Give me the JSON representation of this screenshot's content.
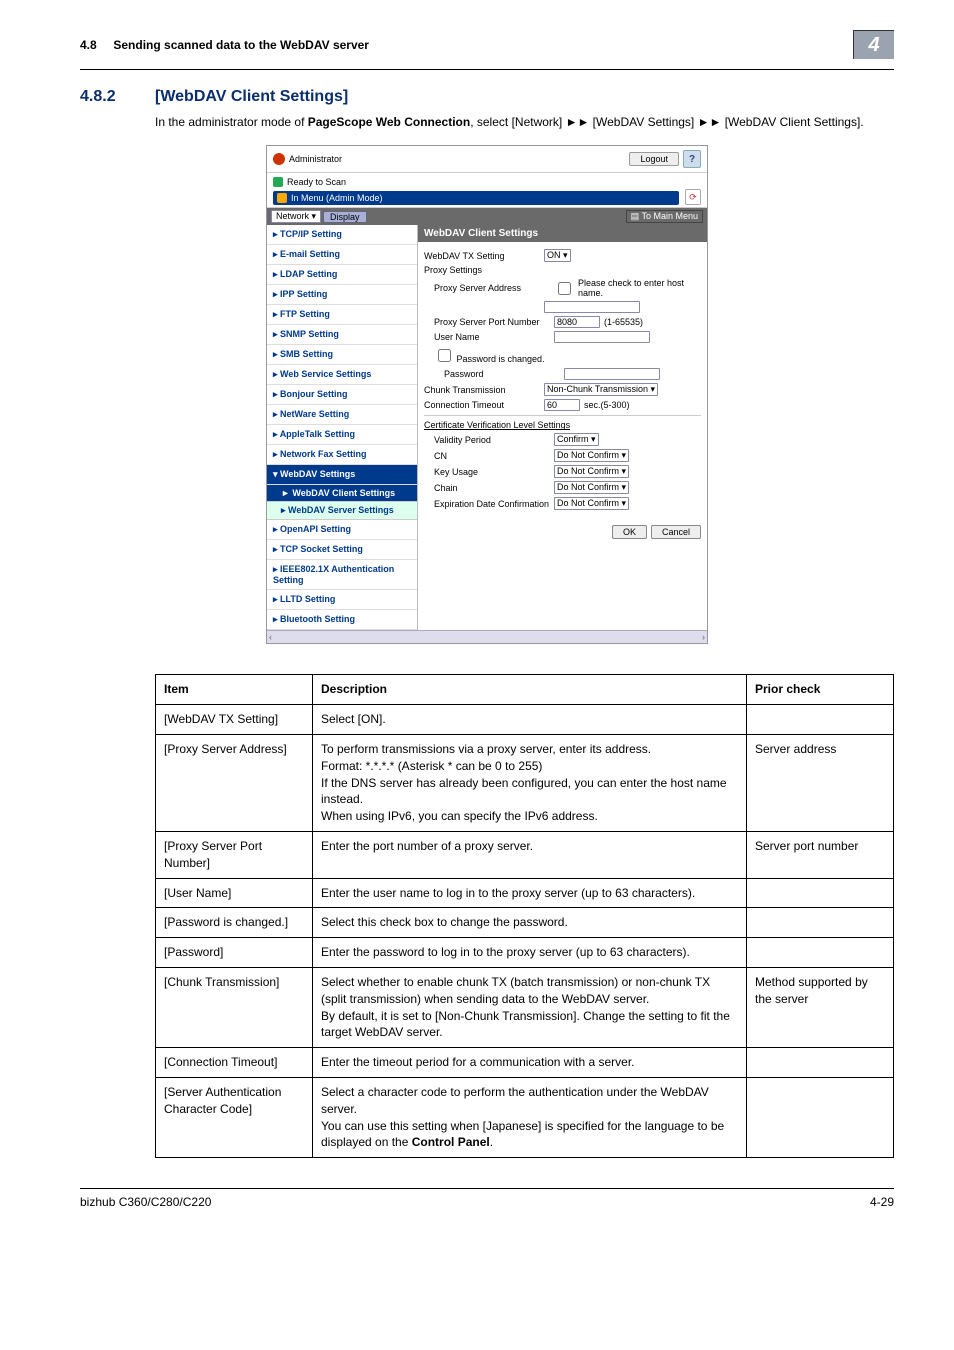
{
  "header": {
    "section_num_top": "4.8",
    "breadcrumb": "Sending scanned data to the WebDAV server",
    "tab_number": "4"
  },
  "section": {
    "num": "4.8.2",
    "title": "[WebDAV Client Settings]",
    "intro": "In the administrator mode of PageScope Web Connection, select [Network] ➤➤ [WebDAV Settings] ➤➤ [WebDAV Client Settings]."
  },
  "shot": {
    "admin": "Administrator",
    "logout": "Logout",
    "help": "?",
    "status1": "Ready to Scan",
    "status2": "In Menu (Admin Mode)",
    "network": "Network",
    "display": "Display",
    "tomain": "To Main Menu",
    "nav": {
      "tcpip": "TCP/IP Setting",
      "email": "E-mail Setting",
      "ldap": "LDAP Setting",
      "ipp": "IPP Setting",
      "ftp": "FTP Setting",
      "snmp": "SNMP Setting",
      "smb": "SMB Setting",
      "ws": "Web Service Settings",
      "bonjour": "Bonjour Setting",
      "netware": "NetWare Setting",
      "appletalk": "AppleTalk Setting",
      "netfax": "Network Fax Setting",
      "webdav": "WebDAV Settings",
      "webdav_client": "WebDAV Client Settings",
      "webdav_server": "WebDAV Server Settings",
      "openapi": "OpenAPI Setting",
      "tcp_socket": "TCP Socket Setting",
      "ieee": "IEEE802.1X Authentication Setting",
      "lltd": "LLTD Setting",
      "bluetooth": "Bluetooth Setting"
    },
    "panel": {
      "title": "WebDAV Client Settings",
      "tx_label": "WebDAV TX Setting",
      "tx_val": "ON",
      "proxy_settings_label": "Proxy Settings",
      "addr_label": "Proxy Server Address",
      "addr_help": "Please check to enter host name.",
      "port_label": "Proxy Server Port Number",
      "port_val": "8080",
      "port_range": "(1-65535)",
      "user_label": "User Name",
      "pw_changed_label": "Password is changed.",
      "pw_label": "Password",
      "chunk_label": "Chunk Transmission",
      "chunk_val": "Non-Chunk Transmission",
      "timeout_label": "Connection Timeout",
      "timeout_val": "60",
      "timeout_unit": "sec.(5-300)",
      "cert_title": "Certificate Verification Level Settings",
      "valid_label": "Validity Period",
      "valid_val": "Confirm",
      "cn_label": "CN",
      "cn_val": "Do Not Confirm",
      "ku_label": "Key Usage",
      "ku_val": "Do Not Confirm",
      "chain_label": "Chain",
      "chain_val": "Do Not Confirm",
      "exp_label": "Expiration Date Confirmation",
      "exp_val": "Do Not Confirm",
      "ok": "OK",
      "cancel": "Cancel"
    }
  },
  "table": {
    "h1": "Item",
    "h2": "Description",
    "h3": "Prior check",
    "rows": [
      {
        "item": "[WebDAV TX Setting]",
        "desc": "Select [ON].",
        "prior": ""
      },
      {
        "item": "[Proxy Server Address]",
        "desc": "To perform transmissions via a proxy server, enter its address.\nFormat: *.*.*.* (Asterisk * can be 0 to 255)\nIf the DNS server has already been configured, you can enter the host name instead.\nWhen using IPv6, you can specify the IPv6 address.",
        "prior": "Server address"
      },
      {
        "item": "[Proxy Server Port Number]",
        "desc": "Enter the port number of a proxy server.",
        "prior": "Server port number"
      },
      {
        "item": "[User Name]",
        "desc": "Enter the user name to log in to the proxy server (up to 63 characters).",
        "prior": ""
      },
      {
        "item": "[Password is changed.]",
        "desc": "Select this check box to change the password.",
        "prior": ""
      },
      {
        "item": "[Password]",
        "desc": "Enter the password to log in to the proxy server (up to 63 characters).",
        "prior": ""
      },
      {
        "item": "[Chunk Transmission]",
        "desc": "Select whether to enable chunk TX (batch transmission) or non-chunk TX (split transmission) when sending data to the WebDAV server.\nBy default, it is set to [Non-Chunk Transmission]. Change the setting to fit the target WebDAV server.",
        "prior": "Method supported by the server"
      },
      {
        "item": "[Connection Timeout]",
        "desc": "Enter the timeout period for a communication with a server.",
        "prior": ""
      },
      {
        "item": "[Server Authentication Character Code]",
        "desc": "Select a character code to perform the authentication under the WebDAV server.\nYou can use this setting when [Japanese] is specified for the language to be displayed on the Control Panel.",
        "prior": ""
      }
    ]
  },
  "footer": {
    "model": "bizhub C360/C280/C220",
    "page": "4-29"
  }
}
